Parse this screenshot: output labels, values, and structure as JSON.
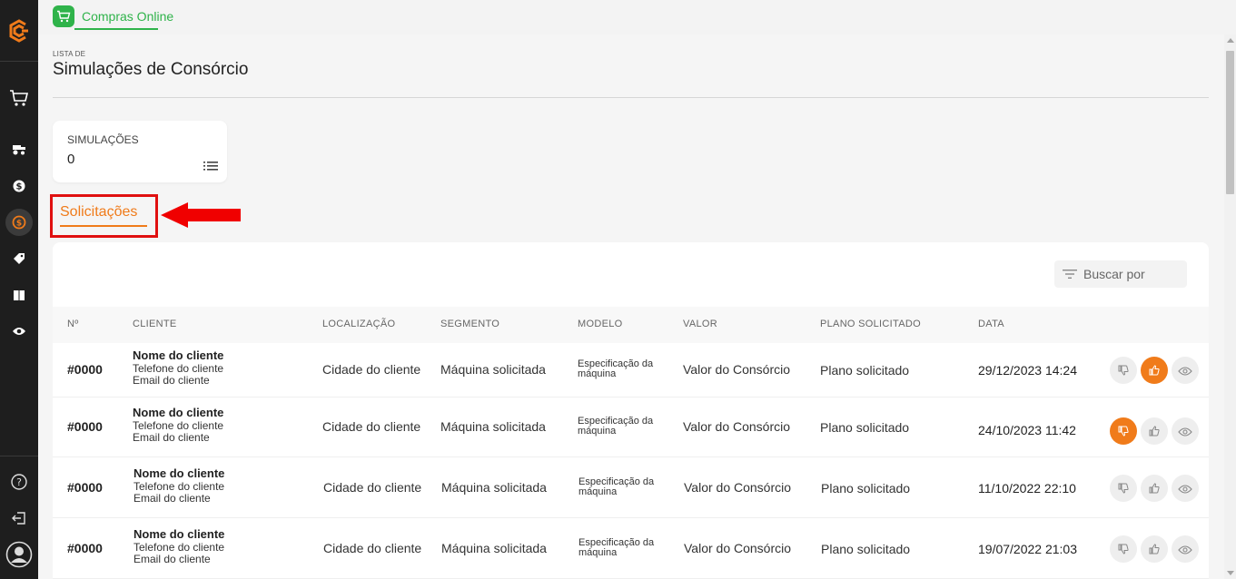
{
  "app": {
    "tab_label": "Compras Online",
    "accent": "#2fb34a",
    "brand_orange": "#f07b1a"
  },
  "sidebar": {
    "items": [
      {
        "icon": "cart-icon"
      },
      {
        "icon": "tractor-icon"
      },
      {
        "icon": "dollar-coin-icon"
      },
      {
        "icon": "consorcio-icon",
        "active": true
      },
      {
        "icon": "tag-icon"
      },
      {
        "icon": "book-icon"
      },
      {
        "icon": "eye-icon"
      }
    ],
    "bottom": [
      {
        "icon": "help-icon"
      },
      {
        "icon": "logout-icon"
      },
      {
        "icon": "user-avatar-icon"
      }
    ]
  },
  "page": {
    "breadcrumb": "LISTA DE",
    "title": "Simulações de Consórcio"
  },
  "stat_card": {
    "label": "SIMULAÇÕES",
    "value": "0"
  },
  "tabs": {
    "solicitacoes": "Solicitações"
  },
  "search": {
    "placeholder": "Buscar por"
  },
  "table": {
    "headers": {
      "num": "Nº",
      "cliente": "CLIENTE",
      "localizacao": "LOCALIZAÇÃO",
      "segmento": "SEGMENTO",
      "modelo": "MODELO",
      "valor": "VALOR",
      "plano": "PLANO SOLICITADO",
      "data": "DATA"
    },
    "rows": [
      {
        "num": "#0000",
        "name": "Nome do cliente",
        "phone": "Telefone do cliente",
        "email": "Email do cliente",
        "city": "Cidade do cliente",
        "segment": "Máquina solicitada",
        "model_1": "Especificação da",
        "model_2": "máquina",
        "value": "Valor do Consórcio",
        "plan": "Plano solicitado",
        "date": "29/12/2023 14:24",
        "status": "approved"
      },
      {
        "num": "#0000",
        "name": "Nome do cliente",
        "phone": "Telefone do cliente",
        "email": "Email do cliente",
        "city": "Cidade do cliente",
        "segment": "Máquina solicitada",
        "model_1": "Especificação da",
        "model_2": "máquina",
        "value": "Valor do Consórcio",
        "plan": "Plano solicitado",
        "date": "24/10/2023 11:42",
        "status": "rejected"
      },
      {
        "num": "#0000",
        "name": "Nome do cliente",
        "phone": "Telefone do cliente",
        "email": "Email do cliente",
        "city": "Cidade do cliente",
        "segment": "Máquina solicitada",
        "model_1": "Especificação da",
        "model_2": "máquina",
        "value": "Valor do Consórcio",
        "plan": "Plano solicitado",
        "date": "11/10/2022 22:10",
        "status": "pending"
      },
      {
        "num": "#0000",
        "name": "Nome do cliente",
        "phone": "Telefone do cliente",
        "email": "Email do cliente",
        "city": "Cidade do cliente",
        "segment": "Máquina solicitada",
        "model_1": "Especificação da",
        "model_2": "máquina",
        "value": "Valor do Consórcio",
        "plan": "Plano solicitado",
        "date": "19/07/2022 21:03",
        "status": "pending"
      }
    ]
  }
}
